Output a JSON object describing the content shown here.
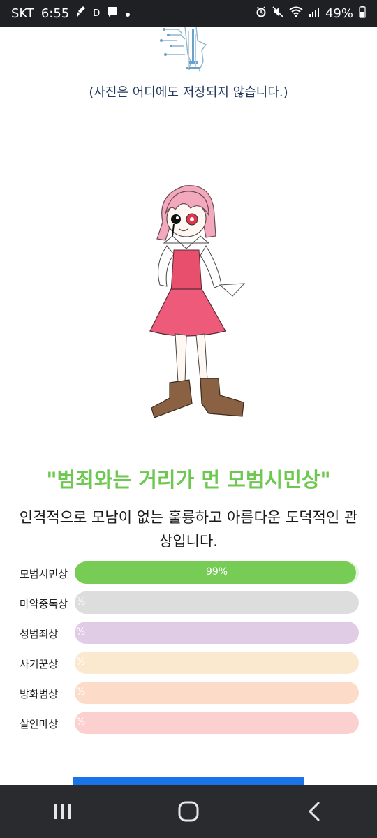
{
  "status_bar": {
    "carrier": "SKT",
    "time": "6:55",
    "app_letter": "D",
    "battery": "49%"
  },
  "notice": "(사진은 어디에도 저장되지 않습니다.)",
  "result": {
    "title": "\"범죄와는 거리가 먼 모범시민상\"",
    "description": "인격적으로 모남이 없는 훌륭하고 아름다운 도덕적인 관상입니다."
  },
  "bars": [
    {
      "label": "모범시민상",
      "percent": 99,
      "text": "99%",
      "fill_color": "#77cc55",
      "track_color": "#e6f5df"
    },
    {
      "label": "마약중독상",
      "percent": 0,
      "text": "%",
      "fill_color": "#dddddd",
      "track_color": "#dddddd"
    },
    {
      "label": "성범죄상",
      "percent": 0,
      "text": "%",
      "fill_color": "#e0cce4",
      "track_color": "#e0cce4"
    },
    {
      "label": "사기꾼상",
      "percent": 0,
      "text": "%",
      "fill_color": "#fbe9cf",
      "track_color": "#fbe9cf"
    },
    {
      "label": "방화범상",
      "percent": 0,
      "text": "%",
      "fill_color": "#fddbc9",
      "track_color": "#fddbc9"
    },
    {
      "label": "살인마상",
      "percent": 0,
      "text": "%",
      "fill_color": "#fdd0d0",
      "track_color": "#fdd0d0"
    }
  ],
  "icons": {
    "status": [
      "paint-brush-icon",
      "chat-icon",
      "dot-icon",
      "alarm-icon",
      "mute-icon",
      "wifi-icon",
      "signal-icon",
      "battery-icon"
    ],
    "nav": [
      "recent-apps-icon",
      "home-icon",
      "back-icon"
    ]
  }
}
